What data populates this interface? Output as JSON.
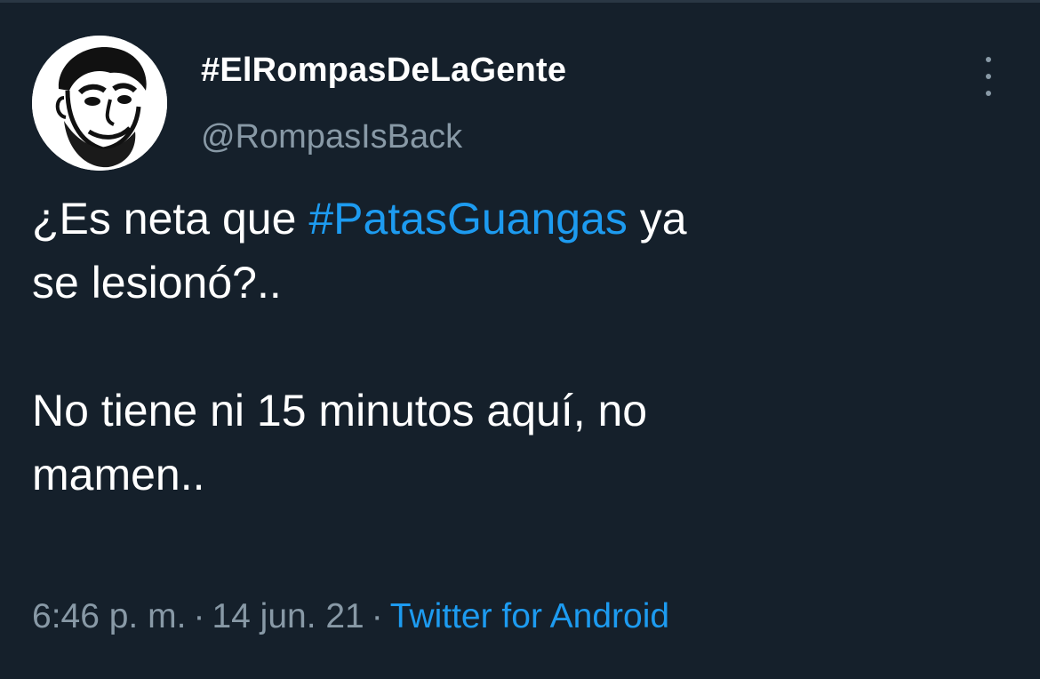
{
  "tweet": {
    "author": {
      "display_name": "#ElRompasDeLaGente",
      "handle": "@RompasIsBack",
      "avatar_icon": "cartoon-face-avatar"
    },
    "more_icon": "vertical-ellipsis-icon",
    "text": {
      "line1_before": "¿Es neta que ",
      "hashtag": "#PatasGuangas",
      "line1_after": " ya",
      "line2": "se lesionó?..",
      "line3": "No tiene ni 15 minutos aquí, no",
      "line4": "mamen.."
    },
    "meta": {
      "time": "6:46 p. m.",
      "separator": "·",
      "date": "14 jun. 21",
      "source": "Twitter for Android"
    }
  },
  "colors": {
    "background": "#15202b",
    "text": "#ffffff",
    "secondary": "#8899a6",
    "accent": "#1d9bf0"
  }
}
